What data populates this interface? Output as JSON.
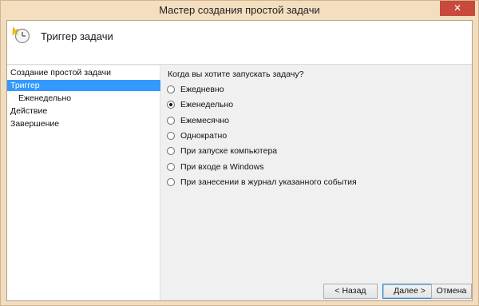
{
  "window": {
    "title": "Мастер создания простой задачи",
    "close_glyph": "✕"
  },
  "header": {
    "title": "Триггер задачи",
    "icon": "task-clock-icon"
  },
  "nav": {
    "items": [
      {
        "label": "Создание простой задачи"
      },
      {
        "label": "Триггер",
        "selected": true
      },
      {
        "label": "Еженедельно"
      },
      {
        "label": "Действие"
      },
      {
        "label": "Завершение"
      }
    ]
  },
  "main": {
    "question": "Когда вы хотите запускать задачу?",
    "options": [
      {
        "label": "Ежедневно",
        "checked": false
      },
      {
        "label": "Еженедельно",
        "checked": true
      },
      {
        "label": "Ежемесячно",
        "checked": false
      },
      {
        "label": "Однократно",
        "checked": false
      },
      {
        "label": "При запуске компьютера",
        "checked": false
      },
      {
        "label": "При входе в Windows",
        "checked": false
      },
      {
        "label": "При занесении в журнал указанного события",
        "checked": false
      }
    ]
  },
  "buttons": {
    "back": "< Назад",
    "next": "Далее >",
    "cancel": "Отмена"
  },
  "colors": {
    "selection": "#3399ff",
    "close": "#c74a3d",
    "frame": "#f3debf"
  }
}
